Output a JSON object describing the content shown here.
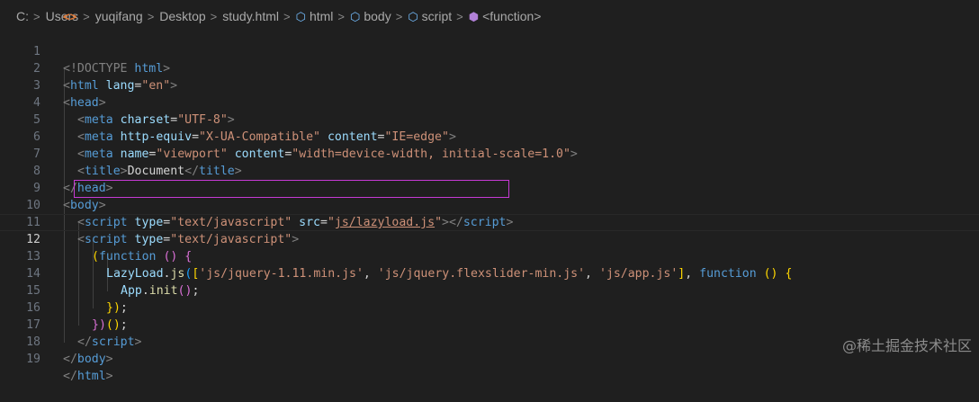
{
  "breadcrumb": {
    "items": [
      {
        "label": "C:",
        "icon": null
      },
      {
        "label": "Users",
        "icon": null
      },
      {
        "label": "yuqifang",
        "icon": null
      },
      {
        "label": "Desktop",
        "icon": null
      },
      {
        "label": "study.html",
        "icon": "html-file-icon",
        "glyph": "<>"
      },
      {
        "label": "html",
        "icon": "element-cube-icon",
        "glyph": "⬡"
      },
      {
        "label": "body",
        "icon": "element-cube-icon",
        "glyph": "⬡"
      },
      {
        "label": "script",
        "icon": "element-cube-icon",
        "glyph": "⬡"
      },
      {
        "label": "<function>",
        "icon": "function-icon",
        "glyph": "⬢"
      }
    ],
    "separator": ">"
  },
  "editor": {
    "current_line": 12,
    "highlighted_line": 10,
    "lines": [
      {
        "n": "1"
      },
      {
        "n": "2"
      },
      {
        "n": "3"
      },
      {
        "n": "4"
      },
      {
        "n": "5"
      },
      {
        "n": "6"
      },
      {
        "n": "7"
      },
      {
        "n": "8"
      },
      {
        "n": "9"
      },
      {
        "n": "10"
      },
      {
        "n": "11"
      },
      {
        "n": "12"
      },
      {
        "n": "13"
      },
      {
        "n": "14"
      },
      {
        "n": "15"
      },
      {
        "n": "16"
      },
      {
        "n": "17"
      },
      {
        "n": "18"
      },
      {
        "n": "19"
      }
    ],
    "tokens": {
      "l1": [
        "<!DOCTYPE",
        " html",
        ">"
      ],
      "l2": [
        "<",
        "html",
        " lang",
        "=",
        "\"en\"",
        ">"
      ],
      "l3": [
        "<",
        "head",
        ">"
      ],
      "l4": [
        "<",
        "meta",
        " charset",
        "=",
        "\"UTF-8\"",
        ">"
      ],
      "l5": [
        "<",
        "meta",
        " http-equiv",
        "=",
        "\"X-UA-Compatible\"",
        " content",
        "=",
        "\"IE=edge\"",
        ">"
      ],
      "l6": [
        "<",
        "meta",
        " name",
        "=",
        "\"viewport\"",
        " content",
        "=",
        "\"width=device-width, initial-scale=1.0\"",
        ">"
      ],
      "l7": [
        "<",
        "title",
        ">",
        "Document",
        "</",
        "title",
        ">"
      ],
      "l8": [
        "</",
        "head",
        ">"
      ],
      "l9": [
        "<",
        "body",
        ">"
      ],
      "l10": [
        "<",
        "script",
        " type",
        "=",
        "\"text/javascript\"",
        " src",
        "=",
        "\"",
        "js/lazyload.js",
        "\"",
        "></",
        "script",
        ">"
      ],
      "l11": [
        "<",
        "script",
        " type",
        "=",
        "\"text/javascript\"",
        ">"
      ],
      "l12": [
        "(",
        "function",
        " ",
        "()",
        " {"
      ],
      "l13": [
        "LazyLoad",
        ".",
        "js",
        "(",
        "[",
        "'js/jquery-1.11.min.js'",
        ", ",
        "'js/jquery.flexslider-min.js'",
        ", ",
        "'js/app.js'",
        "]",
        ", ",
        "function",
        " ",
        "()",
        " {"
      ],
      "l14": [
        "App",
        ".",
        "init",
        "()",
        ";"
      ],
      "l15": [
        "})",
        ";"
      ],
      "l16": [
        "})",
        "()",
        ";"
      ],
      "l17": [
        "</",
        "script",
        ">"
      ],
      "l18": [
        "</",
        "body",
        ">"
      ],
      "l19": [
        "</",
        "html",
        ">"
      ]
    }
  },
  "watermark": "@稀土掘金技术社区",
  "colors": {
    "background": "#1f1f1f",
    "tag": "#569cd6",
    "attribute": "#9cdcfe",
    "string": "#ce9178",
    "function": "#dcdcaa",
    "selection_border": "#c63ad4"
  }
}
